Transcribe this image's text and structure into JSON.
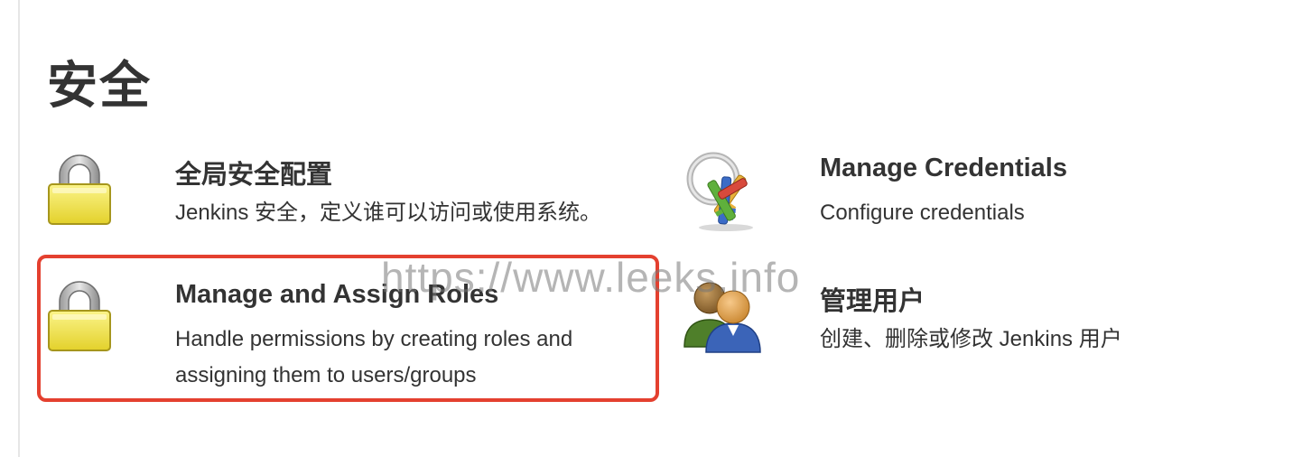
{
  "section": {
    "title": "安全"
  },
  "tiles": [
    {
      "id": "global-security",
      "title": "全局安全配置",
      "description": "Jenkins 安全，定义谁可以访问或使用系统。",
      "icon": "padlock-icon"
    },
    {
      "id": "manage-credentials",
      "title": "Manage Credentials",
      "description": "Configure credentials",
      "icon": "keys-icon"
    },
    {
      "id": "manage-roles",
      "title": "Manage and Assign Roles",
      "description_line1": "Handle permissions by creating roles and",
      "description_line2": "assigning them to users/groups",
      "icon": "padlock-icon"
    },
    {
      "id": "manage-users",
      "title": "管理用户",
      "description": "创建、删除或修改 Jenkins 用户",
      "icon": "users-icon"
    }
  ],
  "annotation": {
    "highlight_color": "#e4402f"
  },
  "watermark": {
    "text": "https://www.leeks.info"
  }
}
